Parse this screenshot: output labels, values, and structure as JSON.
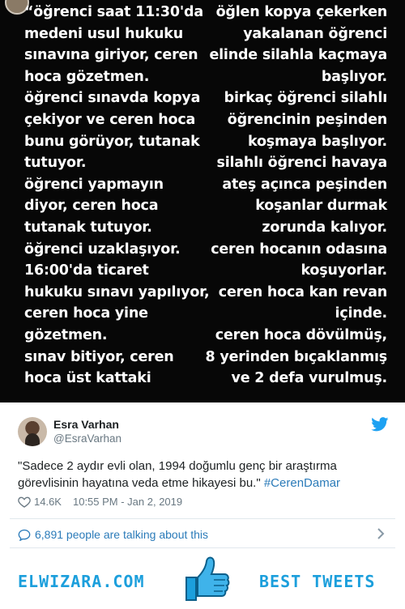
{
  "image": {
    "left_text": "“öğrenci saat 11:30'da\nmedeni usul hukuku\nsınavına giriyor, ceren\nhoca gözetmen.\nöğrenci sınavda kopya\nçekiyor ve ceren hoca\nbunu görüyor, tutanak\ntutuyor.\nöğrenci yapmayın\ndiyor, ceren hoca\ntutanak tutuyor.\nöğrenci uzaklaşıyor.\n16:00'da ticaret\nhukuku sınavı yapılıyor,\nceren hoca yine\ngözetmen.\nsınav bitiyor, ceren\nhoca üst kattaki",
    "right_text": "öğlen kopya çekerken\nyakalanan öğrenci\nelinde silahla kaçmaya\nbaşlıyor.\nbirkaç öğrenci silahlı\nöğrencinin peşinden\nkoşmaya başlıyor.\nsilahlı öğrenci havaya\nateş açınca peşinden\nkoşanlar durmak\nzorunda kalıyor.\nceren hocanın odasına\nkoşuyorlar.\nceren hoca kan revan\niçinde.\nceren hoca dövülmüş,\n8 yerinden bıçaklanmış\nve 2 defa vurulmuş."
  },
  "tweet": {
    "author_name": "Esra Varhan",
    "author_handle": "@EsraVarhan",
    "text": "\"Sadece 2 aydır evli olan, 1994 doğumlu genç bir araştırma görevlisinin hayatına veda etme hikayesi bu.\" ",
    "hashtag": "#CerenDamar",
    "likes": "14.6K",
    "timestamp": "10:55 PM - Jan 2, 2019",
    "talking": "6,891 people are talking about this"
  },
  "footer": {
    "brand": "ELWIZARA.COM",
    "label": "BEST TWEETS"
  },
  "colors": {
    "link": "#2b7bb9",
    "brand": "#1c9fdc",
    "photo_bg": "#070707"
  }
}
